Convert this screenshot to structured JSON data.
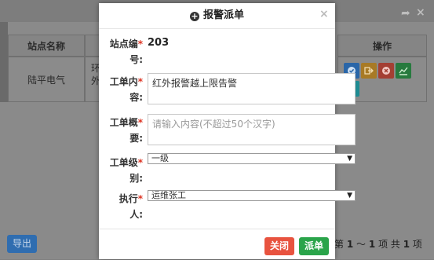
{
  "background": {
    "table": {
      "col_station": "站点名称",
      "col_ops": "操作",
      "row_station": "陆平电气",
      "row_col2_line1": "环",
      "row_col2_line2": "外"
    },
    "export_label": "导出",
    "pager": {
      "prefix": "第",
      "from": "1",
      "sep": "～",
      "to": "1",
      "mid": "项 共",
      "total": "1",
      "suffix": "项"
    },
    "op_buttons": [
      {
        "name": "view-icon",
        "color": "#1e88e5"
      },
      {
        "name": "forward-icon",
        "color": "#f0a020"
      },
      {
        "name": "cancel-icon",
        "color": "#e8533f"
      },
      {
        "name": "trend-icon",
        "color": "#2aa44a"
      },
      {
        "name": "video-icon",
        "color": "#1ab9c4"
      }
    ]
  },
  "modal": {
    "title": "报警派单",
    "station_no_label_1": "站点编",
    "station_no_label_2": "号:",
    "station_no_value": "203",
    "content_label_1": "工单内",
    "content_label_2": "容:",
    "content_value": "红外报警越上限告警",
    "summary_label_1": "工单概",
    "summary_label_2": "要:",
    "summary_placeholder": "请输入内容(不超过50个汉字)",
    "level_label_1": "工单级",
    "level_label_2": "别:",
    "level_value": "一级",
    "executor_label_1": "执行",
    "executor_label_2": "人:",
    "executor_value": "运维张工",
    "close_label": "关闭",
    "dispatch_label": "派单"
  }
}
